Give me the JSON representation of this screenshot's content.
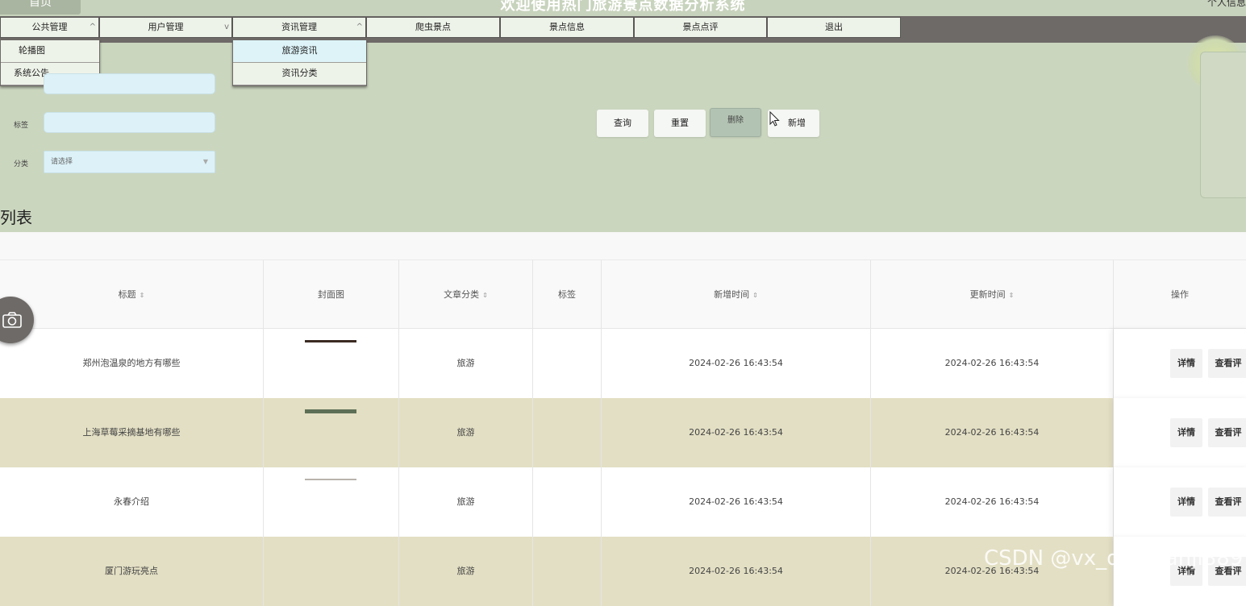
{
  "header": {
    "top_left": "首页",
    "title": "欢迎使用热门旅游景点数据分析系统",
    "user_info": "个人信息"
  },
  "nav": {
    "items": [
      {
        "label": "公共管理",
        "chevron": "chevron-up-icon"
      },
      {
        "label": "用户管理",
        "chevron": "chevron-down-icon"
      },
      {
        "label": "资讯管理",
        "chevron": "chevron-up-icon"
      },
      {
        "label": "爬虫景点"
      },
      {
        "label": "景点信息"
      },
      {
        "label": "景点点评"
      },
      {
        "label": "退出"
      }
    ],
    "dropdown_public": [
      "轮播图",
      "系统公告"
    ],
    "dropdown_news": [
      "旅游资讯",
      "资讯分类"
    ]
  },
  "filters": {
    "tag_label": "标签",
    "category_label": "分类",
    "category_placeholder": "请选择"
  },
  "actions": {
    "query": "查询",
    "reset": "重置",
    "delete": "删除",
    "add": "新增"
  },
  "list": {
    "title": "列表",
    "columns": [
      "标题",
      "封面图",
      "文章分类",
      "标签",
      "新增时间",
      "更新时间",
      "操作"
    ],
    "sortable": [
      true,
      false,
      true,
      false,
      true,
      true,
      false
    ],
    "rows": [
      {
        "title": "郑州泡温泉的地方有哪些",
        "category": "旅游",
        "tag": "",
        "created": "2024-02-26 16:43:54",
        "updated": "2024-02-26 16:43:54",
        "cover_color": "#3a2b22"
      },
      {
        "title": "上海草莓采摘基地有哪些",
        "category": "旅游",
        "tag": "",
        "created": "2024-02-26 16:43:54",
        "updated": "2024-02-26 16:43:54",
        "cover_color": "#5d6f56"
      },
      {
        "title": "永春介绍",
        "category": "旅游",
        "tag": "",
        "created": "2024-02-26 16:43:54",
        "updated": "2024-02-26 16:43:54",
        "cover_color": "#b9b3ad"
      },
      {
        "title": "厦门游玩亮点",
        "category": "旅游",
        "tag": "",
        "created": "2024-02-26 16:43:54",
        "updated": "2024-02-26 16:43:54",
        "cover_color": ""
      }
    ],
    "row_actions": [
      "详情",
      "查看评"
    ]
  },
  "watermark": "CSDN @vx_danpianji889"
}
